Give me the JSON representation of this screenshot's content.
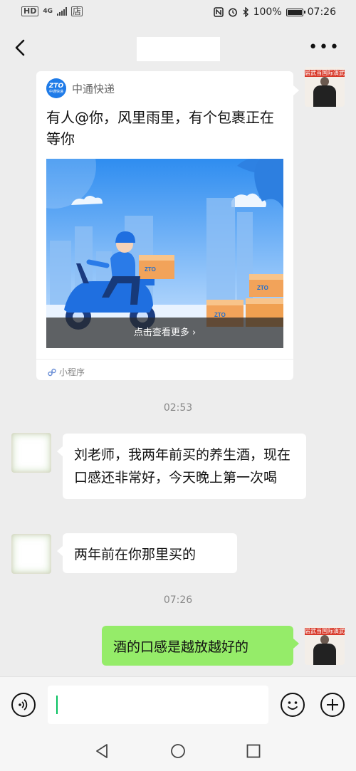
{
  "status_bar": {
    "left_badge": "HD",
    "network": "4G",
    "store_glyph": "店",
    "battery": "100%",
    "time": "07:26",
    "icons": [
      "nfc-icon",
      "alarm-icon",
      "bluetooth-icon",
      "battery-icon"
    ]
  },
  "nav": {
    "back_icon": "chevron-left-icon",
    "more_icon": "more-dots-icon",
    "more_label": "•••"
  },
  "mini_program_card": {
    "brand": "中通快递",
    "logo_text": "ZTO",
    "logo_subtext": "中通快递",
    "title": "有人@你，风里雨里，有个包裹正在等你",
    "overlay": "点击查看更多 ›",
    "footer": "小程序",
    "box_label": "ZTO"
  },
  "messages": [
    {
      "type": "time",
      "text": "02:53"
    },
    {
      "type": "incoming",
      "text": "刘老师，我两年前买的养生酒，现在口感还非常好，今天晚上第一次喝"
    },
    {
      "type": "incoming",
      "text": "两年前在你那里买的"
    },
    {
      "type": "time",
      "text": "07:26"
    },
    {
      "type": "outgoing",
      "text": "酒的口感是越放越好的"
    }
  ],
  "avatar_banner_text": "届武当国际演武",
  "colors": {
    "accent_green": "#07c160",
    "outgoing_bubble": "#95ec69",
    "zto_blue": "#1f7be8",
    "background": "#ededed"
  }
}
